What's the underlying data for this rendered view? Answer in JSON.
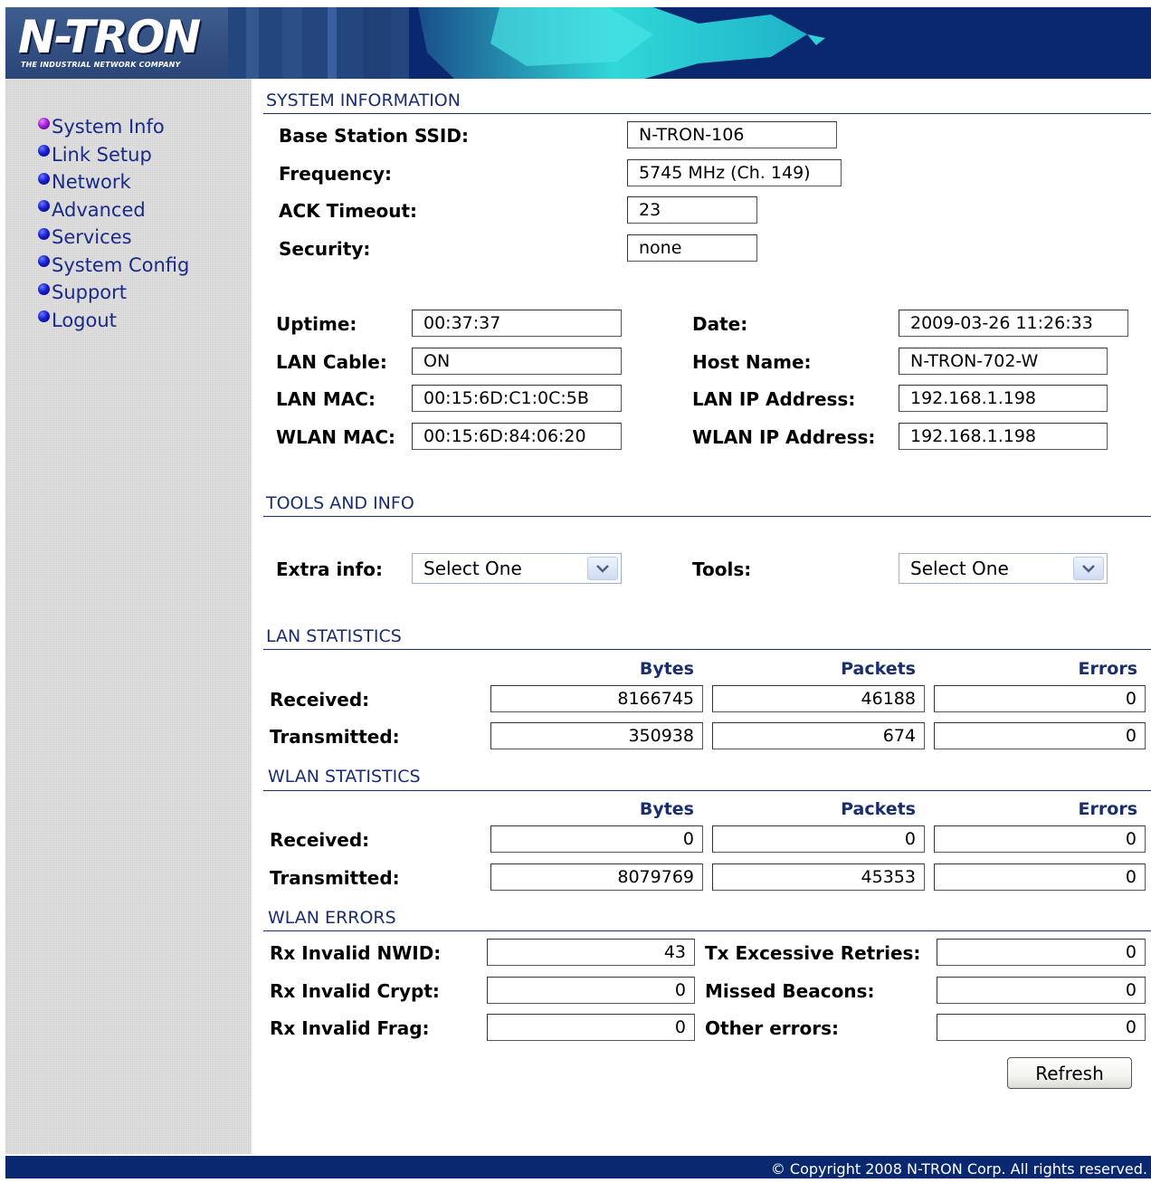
{
  "brand": {
    "logo_text": "N-TRON",
    "tagline": "THE INDUSTRIAL NETWORK COMPANY"
  },
  "colors": {
    "banner": "#0a2870",
    "section_title": "#1a2e6e",
    "nav_link": "#1a2a8a",
    "sidebar_bg": "#e6e6e6"
  },
  "sidebar": {
    "items": [
      {
        "label": "System Info",
        "active": true
      },
      {
        "label": "Link Setup"
      },
      {
        "label": "Network"
      },
      {
        "label": "Advanced"
      },
      {
        "label": "Services"
      },
      {
        "label": "System Config"
      },
      {
        "label": "Support"
      },
      {
        "label": "Logout"
      }
    ]
  },
  "system_info": {
    "title": "SYSTEM INFORMATION",
    "ssid": {
      "label": "Base Station SSID:",
      "value": "N-TRON-106"
    },
    "frequency": {
      "label": "Frequency:",
      "value": "5745 MHz (Ch. 149)"
    },
    "ack_timeout": {
      "label": "ACK Timeout:",
      "value": "23"
    },
    "security": {
      "label": "Security:",
      "value": "none"
    },
    "uptime": {
      "label": "Uptime:",
      "value": "00:37:37"
    },
    "lan_cable": {
      "label": "LAN Cable:",
      "value": "ON"
    },
    "lan_mac": {
      "label": "LAN MAC:",
      "value": "00:15:6D:C1:0C:5B"
    },
    "wlan_mac": {
      "label": "WLAN MAC:",
      "value": "00:15:6D:84:06:20"
    },
    "date": {
      "label": "Date:",
      "value": "2009-03-26 11:26:33"
    },
    "host_name": {
      "label": "Host Name:",
      "value": "N-TRON-702-W"
    },
    "lan_ip": {
      "label": "LAN IP Address:",
      "value": "192.168.1.198"
    },
    "wlan_ip": {
      "label": "WLAN IP Address:",
      "value": "192.168.1.198"
    }
  },
  "tools": {
    "title": "TOOLS AND INFO",
    "extra_info": {
      "label": "Extra info:",
      "selected": "Select One"
    },
    "tools": {
      "label": "Tools:",
      "selected": "Select One"
    }
  },
  "columns": {
    "bytes": "Bytes",
    "packets": "Packets",
    "errors": "Errors"
  },
  "lan_stats": {
    "title": "LAN STATISTICS",
    "received": {
      "label": "Received:",
      "bytes": "8166745",
      "packets": "46188",
      "errors": "0"
    },
    "transmitted": {
      "label": "Transmitted:",
      "bytes": "350938",
      "packets": "674",
      "errors": "0"
    }
  },
  "wlan_stats": {
    "title": "WLAN STATISTICS",
    "received": {
      "label": "Received:",
      "bytes": "0",
      "packets": "0",
      "errors": "0"
    },
    "transmitted": {
      "label": "Transmitted:",
      "bytes": "8079769",
      "packets": "45353",
      "errors": "0"
    }
  },
  "wlan_errors": {
    "title": "WLAN ERRORS",
    "rx_invalid_nwid": {
      "label": "Rx Invalid NWID:",
      "value": "43"
    },
    "rx_invalid_crypt": {
      "label": "Rx Invalid Crypt:",
      "value": "0"
    },
    "rx_invalid_frag": {
      "label": "Rx Invalid Frag:",
      "value": "0"
    },
    "tx_excessive_retries": {
      "label": "Tx Excessive Retries:",
      "value": "0"
    },
    "missed_beacons": {
      "label": "Missed Beacons:",
      "value": "0"
    },
    "other_errors": {
      "label": "Other errors:",
      "value": "0"
    }
  },
  "refresh_label": "Refresh",
  "footer": "© Copyright 2008 N-TRON Corp. All rights reserved."
}
